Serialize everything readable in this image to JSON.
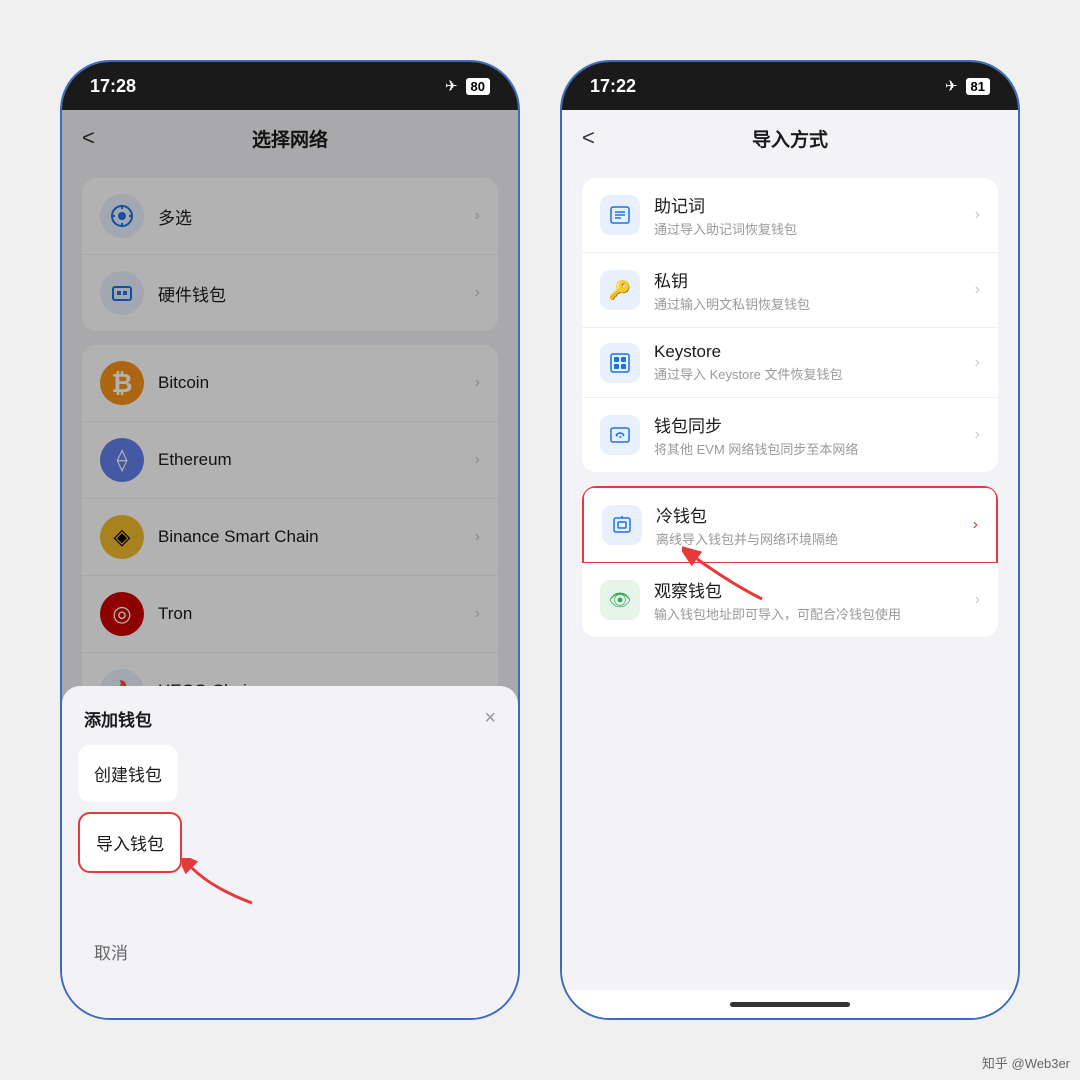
{
  "phone_left": {
    "status": {
      "time": "17:28",
      "airplane": "✈",
      "battery": "80"
    },
    "nav": {
      "back": "<",
      "title": "选择网络"
    },
    "networks": [
      {
        "id": "multiselect",
        "label": "多选",
        "icon": "⊕",
        "icon_class": "icon-multiselect"
      },
      {
        "id": "hardware",
        "label": "硬件钱包",
        "icon": "▣",
        "icon_class": "icon-hardware"
      },
      {
        "id": "bitcoin",
        "label": "Bitcoin",
        "icon": "₿",
        "icon_class": "icon-bitcoin"
      },
      {
        "id": "ethereum",
        "label": "Ethereum",
        "icon": "⟠",
        "icon_class": "icon-ethereum"
      },
      {
        "id": "binance",
        "label": "Binance Smart Chain",
        "icon": "◈",
        "icon_class": "icon-binance"
      },
      {
        "id": "tron",
        "label": "Tron",
        "icon": "◎",
        "icon_class": "icon-tron"
      },
      {
        "id": "heco",
        "label": "HECO Chain",
        "icon": "🔥",
        "icon_class": "icon-heco"
      }
    ],
    "bottom_sheet": {
      "title": "添加钱包",
      "close": "×",
      "buttons": [
        "创建钱包",
        "导入钱包",
        "取消"
      ]
    }
  },
  "phone_right": {
    "status": {
      "time": "17:22",
      "airplane": "✈",
      "battery": "81"
    },
    "nav": {
      "back": "<",
      "title": "导入方式"
    },
    "import_methods": [
      {
        "id": "mnemonic",
        "title": "助记词",
        "subtitle": "通过导入助记词恢复钱包",
        "icon": "▦",
        "icon_class": "import-icon-blue",
        "highlighted": false
      },
      {
        "id": "privatekey",
        "title": "私钥",
        "subtitle": "通过输入明文私钥恢复钱包",
        "icon": "🔑",
        "icon_class": "import-icon-blue",
        "highlighted": false
      },
      {
        "id": "keystore",
        "title": "Keystore",
        "subtitle": "通过导入 Keystore 文件恢复钱包",
        "icon": "⊞",
        "icon_class": "import-icon-blue",
        "highlighted": false
      },
      {
        "id": "walletsync",
        "title": "钱包同步",
        "subtitle": "将其他 EVM 网络钱包同步至本网络",
        "icon": "⊡",
        "icon_class": "import-icon-blue",
        "highlighted": false
      }
    ],
    "import_methods_2": [
      {
        "id": "coldwallet",
        "title": "冷钱包",
        "subtitle": "离线导入钱包并与网络环境隔绝",
        "icon": "▦",
        "icon_class": "import-icon-blue",
        "highlighted": true
      },
      {
        "id": "watchonly",
        "title": "观察钱包",
        "subtitle": "输入钱包地址即可导入，可配合冷钱包使用",
        "icon": "👁",
        "icon_class": "import-icon-green",
        "highlighted": false
      }
    ]
  },
  "watermark": "知乎 @Web3er"
}
